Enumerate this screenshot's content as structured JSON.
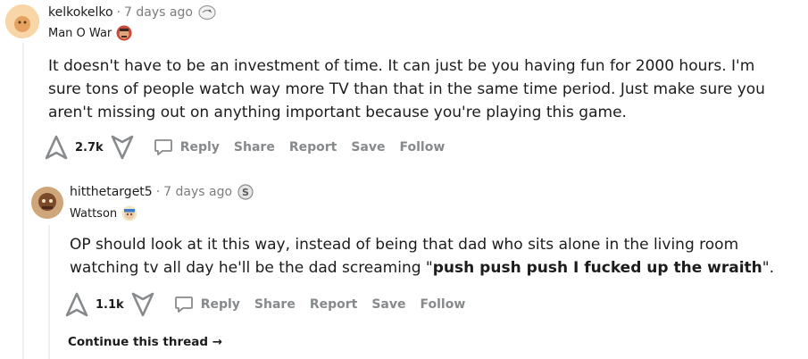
{
  "comments": [
    {
      "username": "kelkokelko",
      "separator": "·",
      "time": "7 days ago",
      "flair": "Man O War",
      "body": "It doesn't have to be an investment of time. It can just be you having fun for 2000 hours. I'm sure tons of people watch way more TV than that in the same time period. Just make sure you aren't missing out on anything important because you're playing this game.",
      "score": "2.7k",
      "actions": {
        "reply": "Reply",
        "share": "Share",
        "report": "Report",
        "save": "Save",
        "follow": "Follow"
      }
    },
    {
      "username": "hitthetarget5",
      "separator": "·",
      "time": "7 days ago",
      "flair": "Wattson",
      "body_pre": "OP should look at it this way, instead of being that dad who sits alone in the living room watching tv all day he'll be the dad screaming \"",
      "body_bold": "push push push I fucked up the wraith",
      "body_post": "\".",
      "score": "1.1k",
      "actions": {
        "reply": "Reply",
        "share": "Share",
        "report": "Report",
        "save": "Save",
        "follow": "Follow"
      }
    }
  ],
  "continue_thread": "Continue this thread →",
  "icons": [
    "upvote-icon",
    "downvote-icon",
    "reply-icon",
    "award-icon",
    "flair-emoji-icon"
  ],
  "colors": {
    "meta_gray": "#7c7c7c",
    "action_gray": "#878a8c",
    "thread_line": "#edeff1",
    "avatar_bg": "#f4c68a"
  }
}
